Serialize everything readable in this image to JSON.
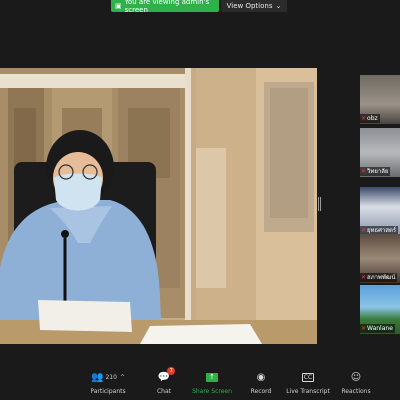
{
  "banner": {
    "sharing_text": "You are viewing admin's screen",
    "sharing_icon": "share-screen-icon",
    "view_options_label": "View Options",
    "view_options_icon": "chevron-down-icon",
    "accent_color": "#2fb14a"
  },
  "gallery": {
    "thumbnails": [
      {
        "label": "obz",
        "muted": true
      },
      {
        "label": "วิทยาลัย",
        "muted": true
      },
      {
        "label": "ยุทธศาสตร์",
        "muted": true
      },
      {
        "label": "สภาพพัฒน์",
        "muted": true
      },
      {
        "label": "Wanlane",
        "muted": true
      }
    ]
  },
  "toolbar": {
    "participants_label": "Participants",
    "participants_count": "210",
    "chat_label": "Chat",
    "chat_badge": "7",
    "share_label": "Share Screen",
    "record_label": "Record",
    "transcript_label": "Live Transcript",
    "transcript_icon_text": "CC",
    "reactions_label": "Reactions"
  }
}
